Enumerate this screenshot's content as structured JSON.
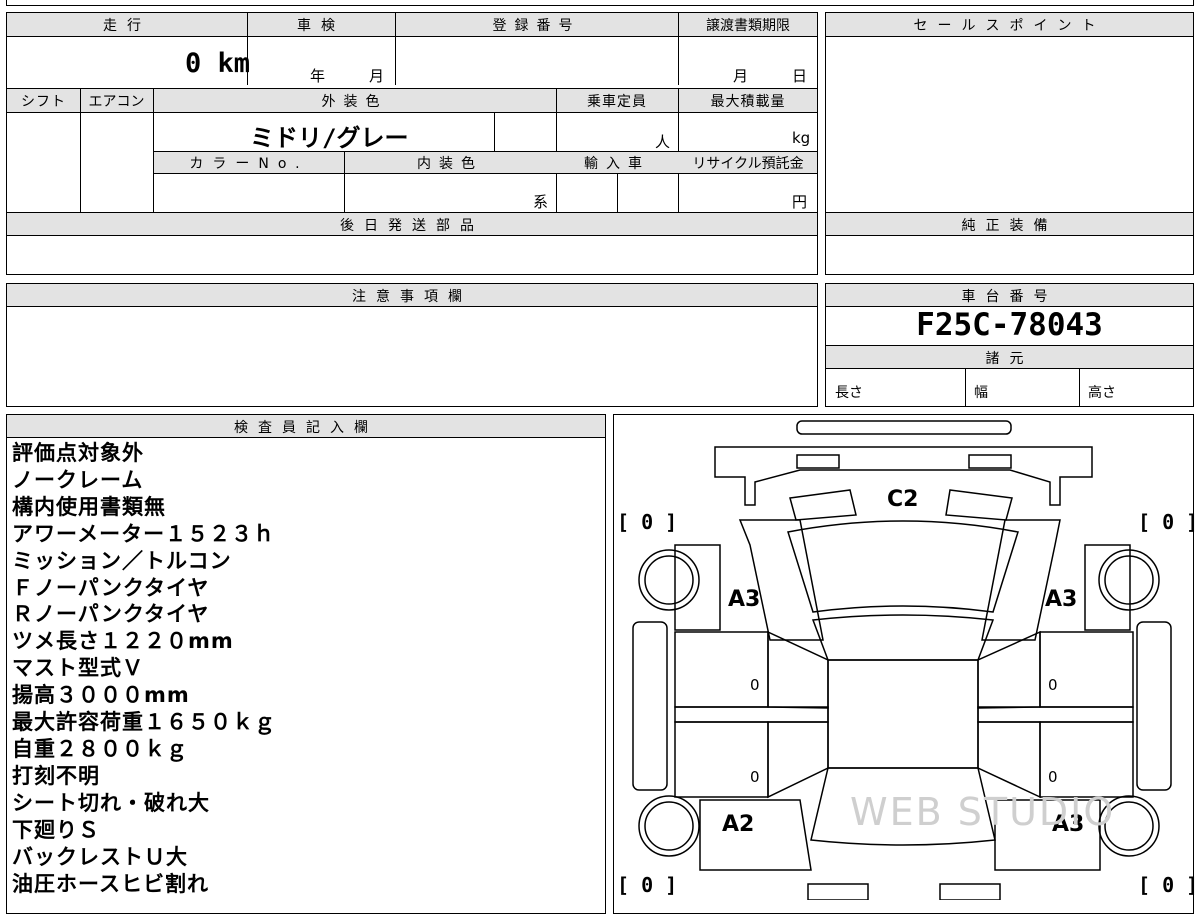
{
  "vehicle_info": {
    "mileage_label": "走行",
    "mileage_value": "0 km",
    "inspection_label": "車検",
    "inspection_year": "年",
    "inspection_month": "月",
    "registration_label": "登録番号",
    "transfer_label": "譲渡書類期限",
    "transfer_month": "月",
    "transfer_day": "日",
    "shift_label": "シフト",
    "aircon_label": "エアコン",
    "exterior_label": "外装色",
    "exterior_value": "ミドリ/グレー",
    "capacity_label": "乗車定員",
    "capacity_unit": "人",
    "max_load_label": "最大積載量",
    "max_load_unit": "kg",
    "color_no_label": "カラーNo.",
    "interior_label": "内装色",
    "interior_unit": "系",
    "import_label": "輸入車",
    "recycle_label": "リサイクル預託金",
    "recycle_unit": "円",
    "later_parts_label": "後日発送部品"
  },
  "sales_point": {
    "label": "セールスポイント"
  },
  "genuine_equipment": {
    "label": "純正装備"
  },
  "caution": {
    "label": "注意事項欄"
  },
  "chassis": {
    "label": "車台番号",
    "number": "F25C-78043",
    "specs_label": "諸元",
    "length_label": "長さ",
    "width_label": "幅",
    "height_label": "高さ"
  },
  "inspector": {
    "label": "検査員記入欄",
    "notes": [
      "評価点対象外",
      "ノークレーム",
      "構内使用書類無",
      "アワーメーター１５２３ｈ",
      "ミッション／トルコン",
      "Ｆノーパンクタイヤ",
      "Ｒノーパンクタイヤ",
      "ツメ長さ１２２０mm",
      "マスト型式Ｖ",
      "揚高３０００mm",
      "最大許容荷重１６５０ｋｇ",
      "自重２８００ｋｇ",
      "打刻不明",
      "シート切れ・破れ大",
      "下廻りＳ",
      "バックレストＵ大",
      "油圧ホースヒビ割れ"
    ]
  },
  "diagram": {
    "top_left_bracket": "[ 0 ]",
    "top_right_bracket": "[ 0 ]",
    "bottom_left_bracket": "[ 0 ]",
    "bottom_right_bracket": "[ 0 ]",
    "front_code": "C2",
    "front_left_code": "A3",
    "front_right_code": "A3",
    "rear_left_code": "A2",
    "rear_right_code": "A3",
    "door_fl": "0",
    "door_fr": "0",
    "door_rl": "0",
    "door_rr": "0",
    "watermark": "WEB STUDIO"
  }
}
